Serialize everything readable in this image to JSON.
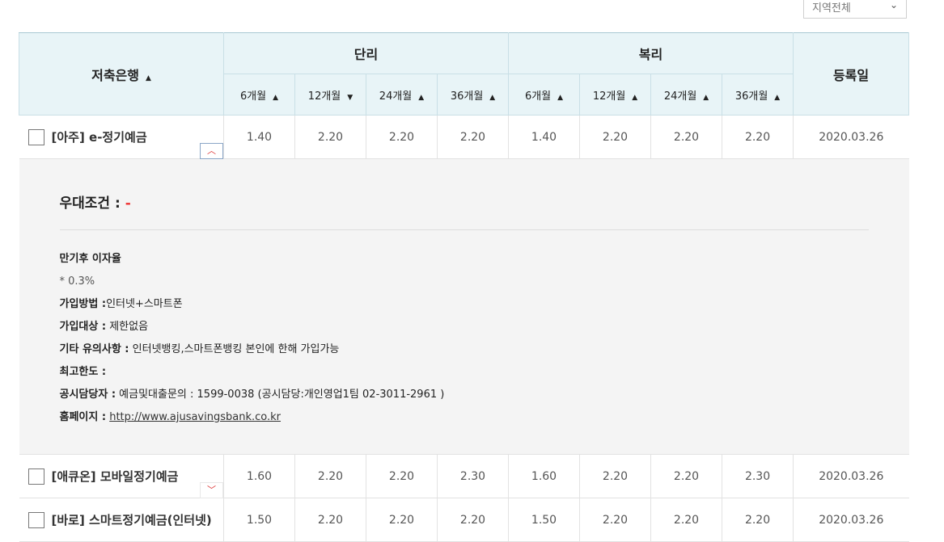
{
  "region_select": {
    "value": "지역전체"
  },
  "headers": {
    "bank": "저축은행",
    "simple": "단리",
    "compound": "복리",
    "registered": "등록일",
    "terms": [
      "6개월",
      "12개월",
      "24개월",
      "36개월",
      "6개월",
      "12개월",
      "24개월",
      "36개월"
    ],
    "term_sort": [
      "up",
      "down",
      "up",
      "up",
      "up",
      "up",
      "up",
      "up"
    ]
  },
  "rows": [
    {
      "bank": "[아주] e-정기예금",
      "rates": [
        "1.40",
        "2.20",
        "2.20",
        "2.20",
        "1.40",
        "2.20",
        "2.20",
        "2.20"
      ],
      "date": "2020.03.26",
      "expanded": true
    },
    {
      "bank": "[애큐온] 모바일정기예금",
      "rates": [
        "1.60",
        "2.20",
        "2.20",
        "2.30",
        "1.60",
        "2.20",
        "2.20",
        "2.30"
      ],
      "date": "2020.03.26",
      "expanded": false
    },
    {
      "bank": "[바로] 스마트정기예금(인터넷)",
      "rates": [
        "1.50",
        "2.20",
        "2.20",
        "2.20",
        "1.50",
        "2.20",
        "2.20",
        "2.20"
      ],
      "date": "2020.03.26",
      "expanded": false
    }
  ],
  "detail": {
    "cond_label": "우대조건 :",
    "cond_value": "-",
    "maturity_label": "만기후 이자율",
    "maturity_rate": "* 0.3%",
    "method_label": "가입방법 :",
    "method_value": "인터넷+스마트폰",
    "target_label": "가입대상 :",
    "target_value": "제한없음",
    "note_label": "기타 유의사항 :",
    "note_value": "인터넷뱅킹,스마트폰뱅킹 본인에 한해 가입가능",
    "limit_label": "최고한도 :",
    "contact_label": "공시담당자 :",
    "contact_value": "예금및대출문의 : 1599-0038 (공시담당:개인영업1팀 02-3011-2961 )",
    "homepage_label": "홈페이지 :",
    "homepage_url": "http://www.ajusavingsbank.co.kr"
  }
}
